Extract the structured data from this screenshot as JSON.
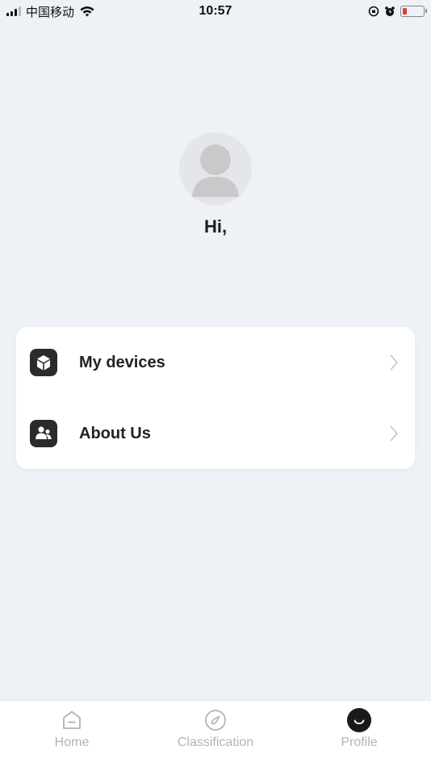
{
  "status_bar": {
    "carrier": "中国移动",
    "time": "10:57"
  },
  "profile": {
    "greeting": "Hi,"
  },
  "menu": {
    "items": [
      {
        "label": "My devices",
        "icon": "cube-icon"
      },
      {
        "label": "About Us",
        "icon": "people-icon"
      }
    ]
  },
  "tab_bar": {
    "tabs": [
      {
        "label": "Home",
        "icon": "home-icon",
        "active": false
      },
      {
        "label": "Classification",
        "icon": "compass-icon",
        "active": false
      },
      {
        "label": "Profile",
        "icon": "profile-icon",
        "active": true
      }
    ]
  },
  "colors": {
    "background": "#eef1f5",
    "card": "#ffffff",
    "icon_dark": "#2b2b2b",
    "tab_inactive": "#b3b3b3",
    "battery_low": "#e23b3b"
  }
}
